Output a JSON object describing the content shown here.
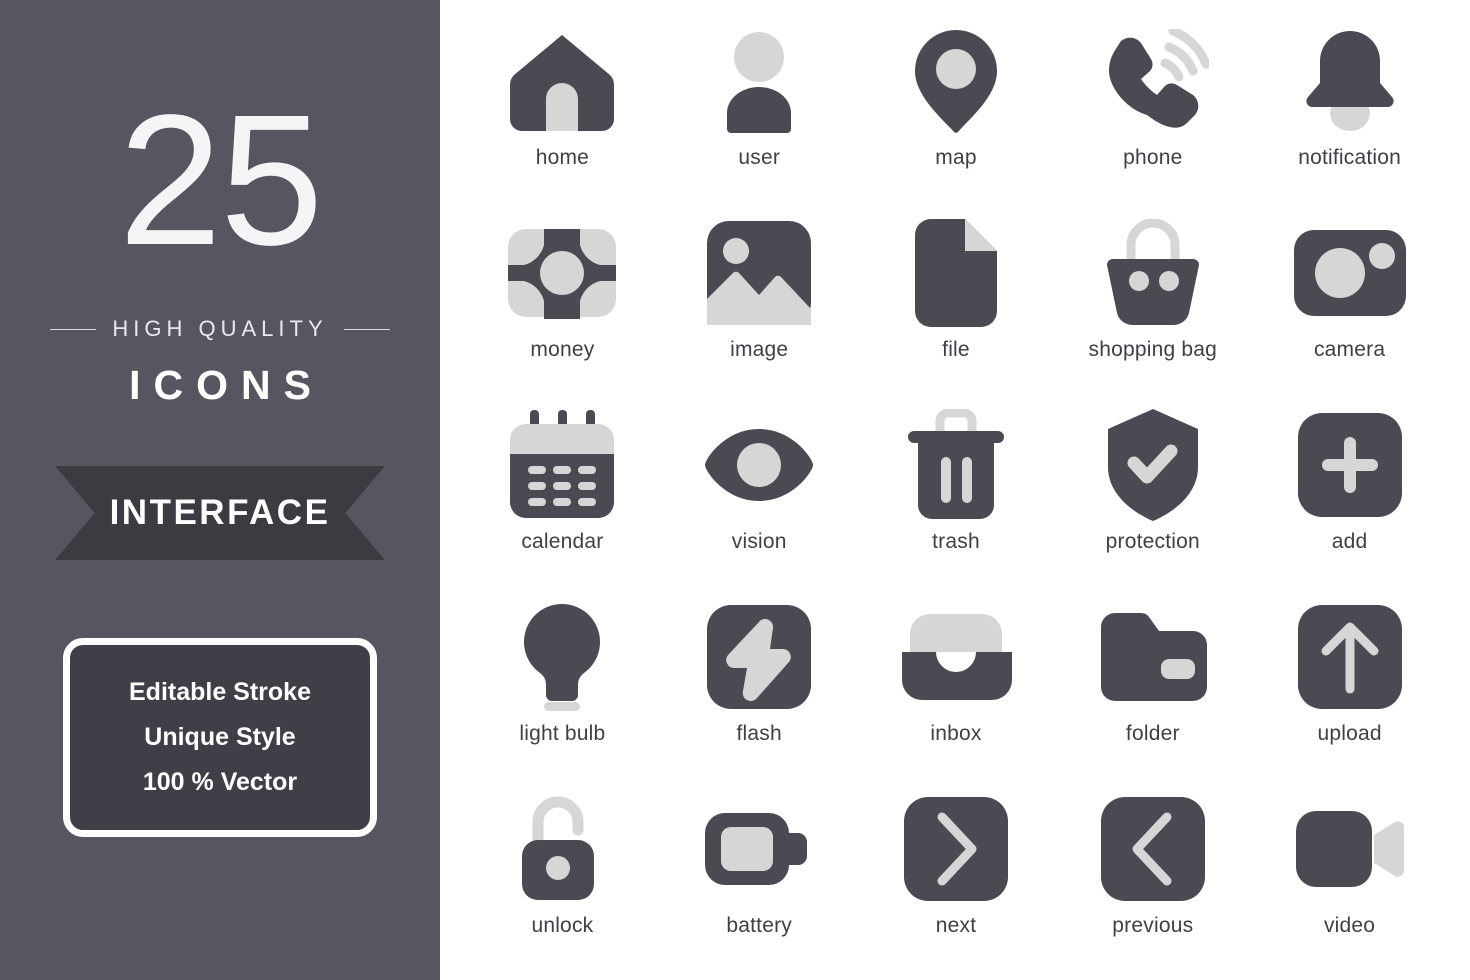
{
  "colors": {
    "sidebar_bg": "#565660",
    "icon_dark": "#4a4a52",
    "icon_light": "#d6d6d6",
    "ribbon_bg": "#3b3b42",
    "page_bg": "#ffffff",
    "label_text": "#3f3f46"
  },
  "sidebar": {
    "count": "25",
    "tagline": "HIGH QUALITY",
    "word": "ICONS",
    "ribbon_label": "INTERFACE",
    "promo": [
      "Editable Stroke",
      "Unique Style",
      "100 % Vector"
    ]
  },
  "grid": {
    "columns": 5,
    "rows": 5,
    "icons": [
      {
        "name": "home-icon",
        "label": "home"
      },
      {
        "name": "user-icon",
        "label": "user"
      },
      {
        "name": "map-icon",
        "label": "map"
      },
      {
        "name": "phone-icon",
        "label": "phone"
      },
      {
        "name": "notification-icon",
        "label": "notification"
      },
      {
        "name": "money-icon",
        "label": "money"
      },
      {
        "name": "image-icon",
        "label": "image"
      },
      {
        "name": "file-icon",
        "label": "file"
      },
      {
        "name": "shopping-bag-icon",
        "label": "shopping bag"
      },
      {
        "name": "camera-icon",
        "label": "camera"
      },
      {
        "name": "calendar-icon",
        "label": "calendar"
      },
      {
        "name": "vision-icon",
        "label": "vision"
      },
      {
        "name": "trash-icon",
        "label": "trash"
      },
      {
        "name": "protection-icon",
        "label": "protection"
      },
      {
        "name": "add-icon",
        "label": "add"
      },
      {
        "name": "light-bulb-icon",
        "label": "light bulb"
      },
      {
        "name": "flash-icon",
        "label": "flash"
      },
      {
        "name": "inbox-icon",
        "label": "inbox"
      },
      {
        "name": "folder-icon",
        "label": "folder"
      },
      {
        "name": "upload-icon",
        "label": "upload"
      },
      {
        "name": "unlock-icon",
        "label": "unlock"
      },
      {
        "name": "battery-icon",
        "label": "battery"
      },
      {
        "name": "next-icon",
        "label": "next"
      },
      {
        "name": "previous-icon",
        "label": "previous"
      },
      {
        "name": "video-icon",
        "label": "video"
      }
    ]
  }
}
